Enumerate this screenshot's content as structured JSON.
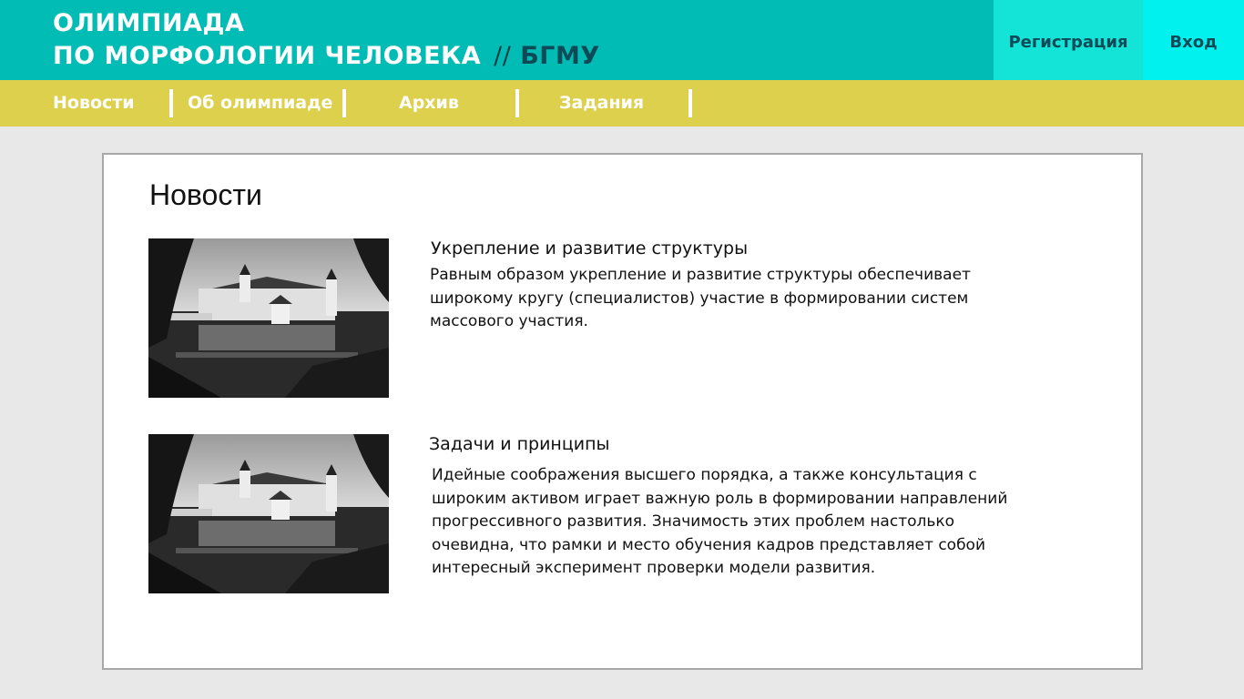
{
  "header": {
    "title_line1": "ОЛИМПИАДА",
    "title_line2": "ПО МОРФОЛОГИИ ЧЕЛОВЕКА",
    "separator": "//",
    "org": "БГМУ",
    "register_label": "Регистрация",
    "login_label": "Вход"
  },
  "nav": {
    "items": [
      {
        "label": "Новости"
      },
      {
        "label": "Об олимпиаде"
      },
      {
        "label": "Архив"
      },
      {
        "label": "Задания"
      }
    ]
  },
  "main": {
    "title": "Новости",
    "news": [
      {
        "title": "Укрепление и развитие структуры",
        "text": "Равным образом укрепление и развитие структуры обеспечивает широкому кругу (специалистов) участие в формировании систем массового участия.",
        "image_icon": "castle-photo"
      },
      {
        "title": "Задачи и принципы",
        "text": "Идейные соображения высшего порядка, а также консультация с широким активом играет важную роль в формировании направлений прогрессивного развития. Значимость этих проблем настолько очевидна, что рамки и место обучения кадров представляет собой интересный эксперимент проверки модели развития.",
        "image_icon": "castle-photo"
      }
    ]
  },
  "colors": {
    "topbar": "#01bcb4",
    "register_bg": "#14e4d8",
    "login_bg": "#00f1ee",
    "navbar": "#dcd04d",
    "page_bg": "#e8e8e8"
  }
}
